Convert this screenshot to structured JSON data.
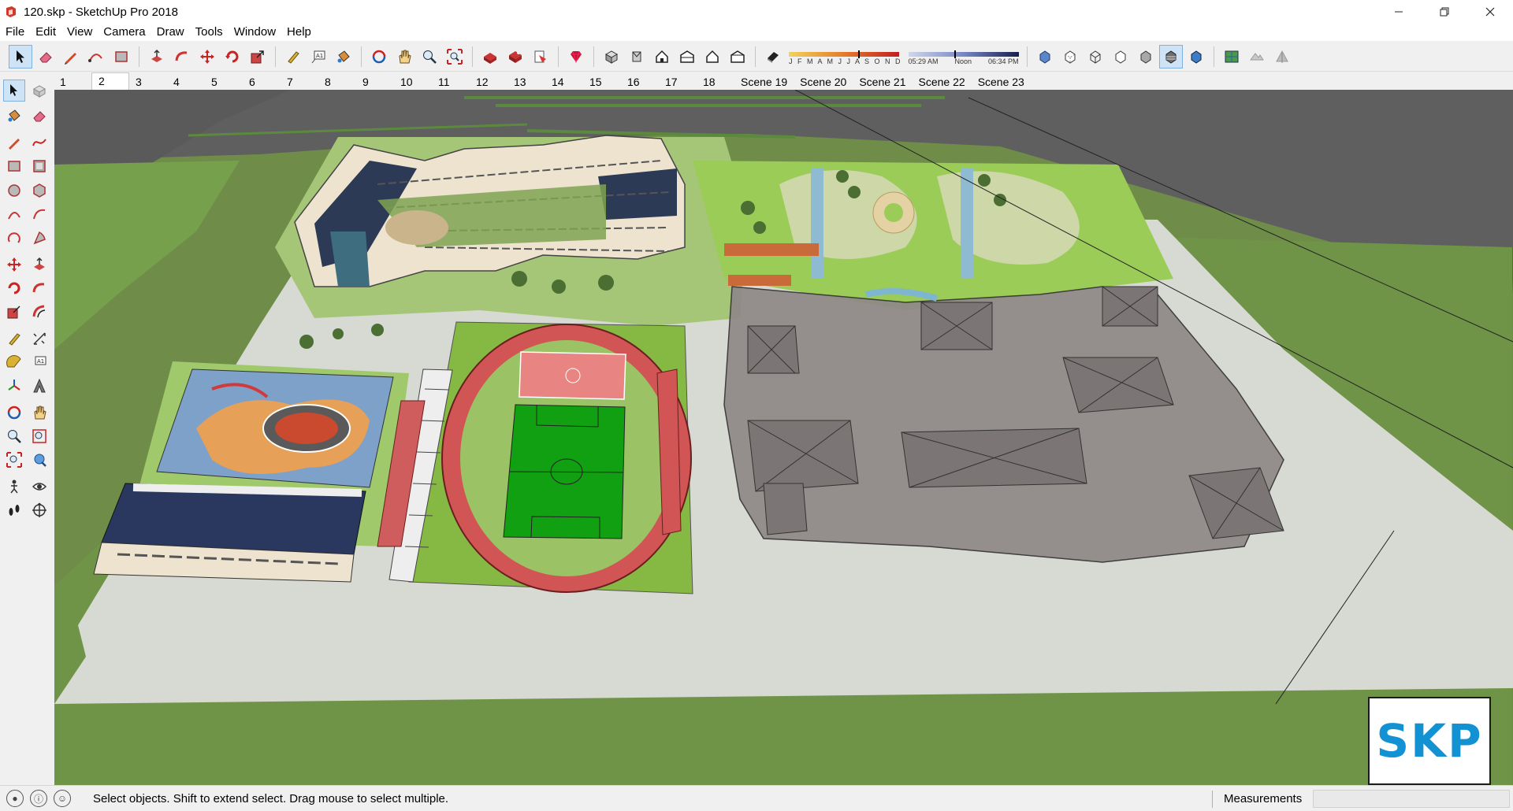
{
  "window": {
    "title": "120.skp - SketchUp Pro 2018",
    "icons": {
      "app": "sketchup-logo-icon",
      "minimize": "minimize-icon",
      "restore": "restore-icon",
      "close": "close-icon"
    }
  },
  "menu": [
    "File",
    "Edit",
    "View",
    "Camera",
    "Draw",
    "Tools",
    "Window",
    "Help"
  ],
  "toolbar": {
    "shadow_months": "J F M A M J J A S O N D",
    "shadow_time_start": "05:29 AM",
    "shadow_time_mid": "Noon",
    "shadow_time_end": "06:34 PM"
  },
  "scenes": {
    "tabs": [
      "1",
      "2",
      "3",
      "4",
      "5",
      "6",
      "7",
      "8",
      "9",
      "10",
      "11",
      "12",
      "13",
      "14",
      "15",
      "16",
      "17",
      "18",
      "Scene 19",
      "Scene 20",
      "Scene 21",
      "Scene 22",
      "Scene 23"
    ],
    "active": "2"
  },
  "viewport": {
    "badge": "SKP",
    "badge_color": "#1392d3"
  },
  "status": {
    "message": "Select objects. Shift to extend select. Drag mouse to select multiple.",
    "measurements_label": "Measurements",
    "measurements_value": ""
  }
}
